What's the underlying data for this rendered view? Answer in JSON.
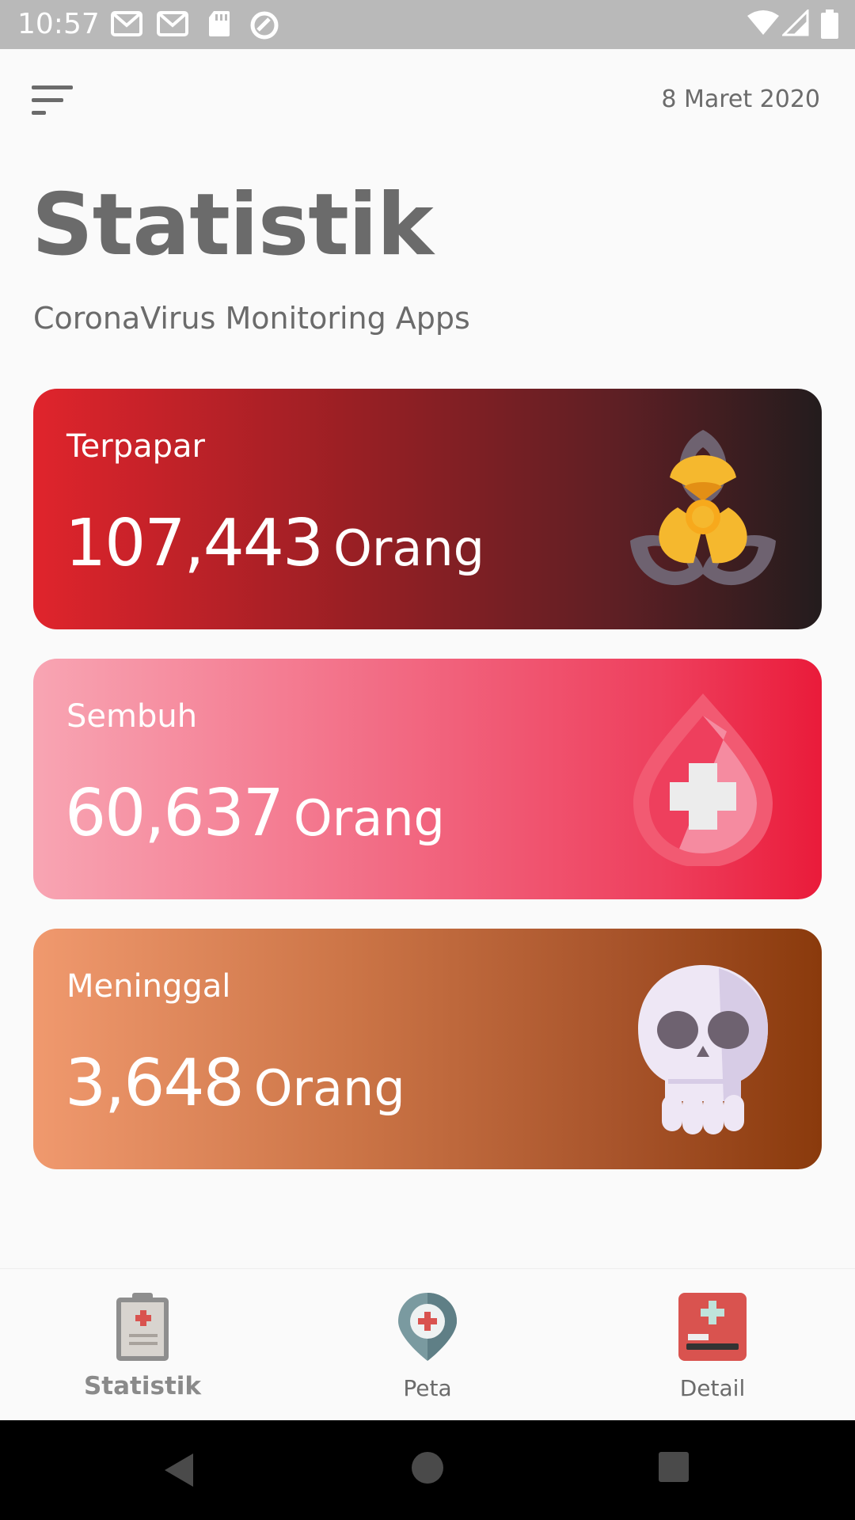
{
  "status_bar": {
    "time": "10:57",
    "icons": [
      "gmail-icon",
      "gmail-icon",
      "sd-card-icon",
      "sync-icon",
      "wifi-icon",
      "signal-icon",
      "battery-icon"
    ]
  },
  "header": {
    "menu_icon": "sort-menu-icon",
    "date": "8 Maret 2020"
  },
  "page": {
    "title": "Statistik",
    "subtitle": "CoronaVirus Monitoring Apps"
  },
  "cards": [
    {
      "label": "Terpapar",
      "value": "107,443",
      "unit": "Orang",
      "icon": "biohazard-icon",
      "colors": [
        "#e0242c",
        "#231c1d"
      ]
    },
    {
      "label": "Sembuh",
      "value": "60,637",
      "unit": "Orang",
      "icon": "blood-drop-cross-icon",
      "colors": [
        "#f8a5b3",
        "#ea1b3a"
      ]
    },
    {
      "label": "Meninggal",
      "value": "3,648",
      "unit": "Orang",
      "icon": "skull-icon",
      "colors": [
        "#f0996e",
        "#8a3a0c"
      ]
    }
  ],
  "bottom_nav": {
    "items": [
      {
        "label": "Statistik",
        "icon": "clipboard-icon",
        "active": true
      },
      {
        "label": "Peta",
        "icon": "map-pin-icon",
        "active": false
      },
      {
        "label": "Detail",
        "icon": "medical-kit-icon",
        "active": false
      }
    ]
  },
  "system_nav": [
    "back-icon",
    "home-icon",
    "recents-icon"
  ]
}
